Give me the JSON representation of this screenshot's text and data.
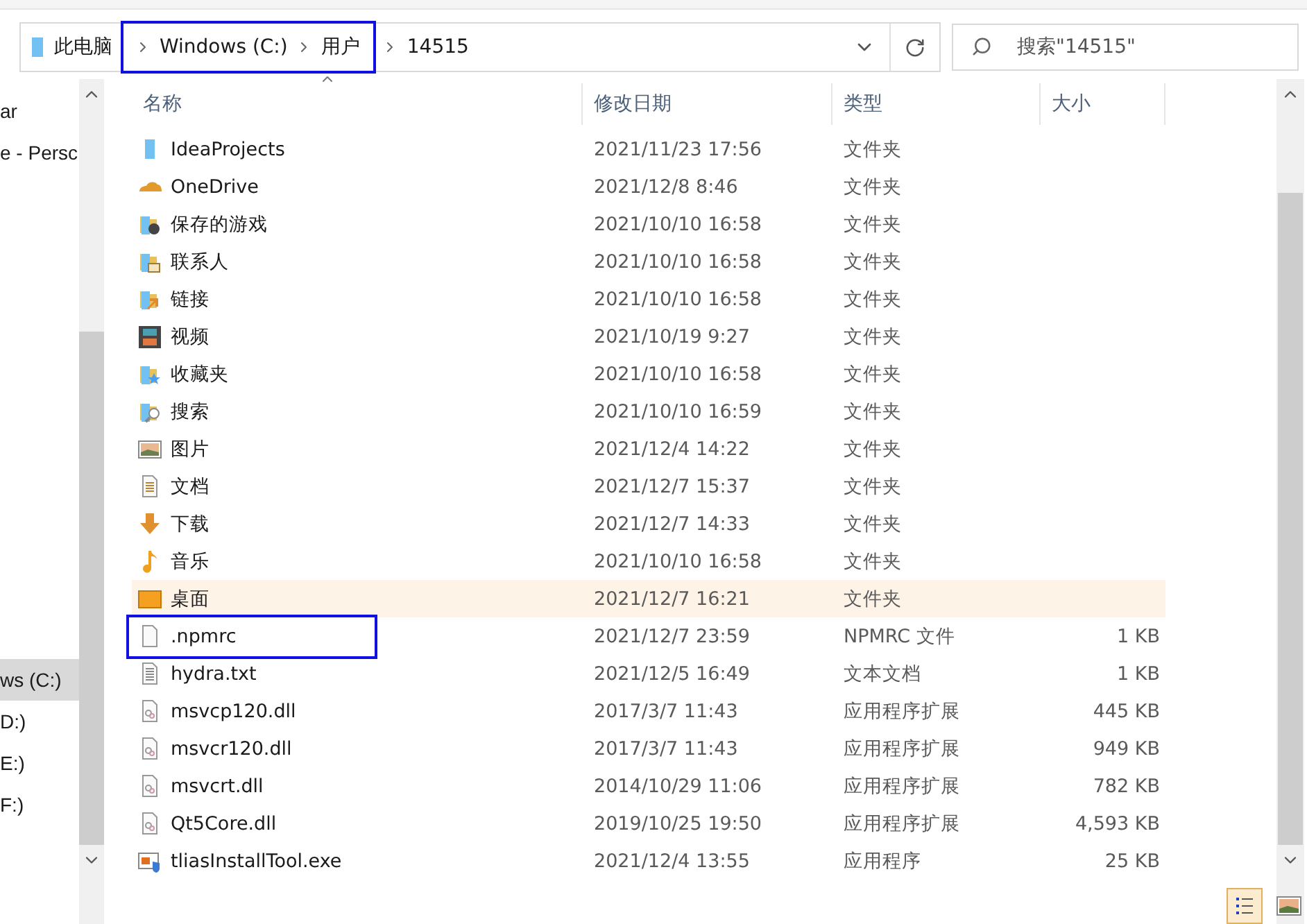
{
  "address_bar": {
    "segments": [
      {
        "label": "此电脑",
        "outlined": false
      },
      {
        "label": "Windows (C:)",
        "outlined": true
      },
      {
        "label": "用户",
        "outlined": true
      },
      {
        "label": "14515",
        "outlined": false
      }
    ]
  },
  "search": {
    "placeholder": "搜索\"14515\""
  },
  "nav_pane": {
    "items": [
      {
        "label": "ar",
        "selected": false
      },
      {
        "label": "e - Persc",
        "selected": false
      },
      {
        "label": "ws (C:)",
        "selected": true
      },
      {
        "label": "D:)",
        "selected": false
      },
      {
        "label": "E:)",
        "selected": false
      },
      {
        "label": "F:)",
        "selected": false
      }
    ]
  },
  "table": {
    "columns": [
      "名称",
      "修改日期",
      "类型",
      "大小"
    ],
    "rows": [
      {
        "kind": "folder",
        "name": "IdeaProjects",
        "date": "2021/11/23 17:56",
        "type": "文件夹",
        "size": "",
        "highlighted": false,
        "outlined": false
      },
      {
        "kind": "cloud",
        "name": "OneDrive",
        "date": "2021/12/8 8:46",
        "type": "文件夹",
        "size": "",
        "highlighted": false,
        "outlined": false
      },
      {
        "kind": "games",
        "name": "保存的游戏",
        "date": "2021/10/10 16:58",
        "type": "文件夹",
        "size": "",
        "highlighted": false,
        "outlined": false
      },
      {
        "kind": "contacts",
        "name": "联系人",
        "date": "2021/10/10 16:58",
        "type": "文件夹",
        "size": "",
        "highlighted": false,
        "outlined": false
      },
      {
        "kind": "links",
        "name": "链接",
        "date": "2021/10/10 16:58",
        "type": "文件夹",
        "size": "",
        "highlighted": false,
        "outlined": false
      },
      {
        "kind": "video",
        "name": "视频",
        "date": "2021/10/19 9:27",
        "type": "文件夹",
        "size": "",
        "highlighted": false,
        "outlined": false
      },
      {
        "kind": "favorites",
        "name": "收藏夹",
        "date": "2021/10/10 16:58",
        "type": "文件夹",
        "size": "",
        "highlighted": false,
        "outlined": false
      },
      {
        "kind": "searches",
        "name": "搜索",
        "date": "2021/10/10 16:59",
        "type": "文件夹",
        "size": "",
        "highlighted": false,
        "outlined": false
      },
      {
        "kind": "pictures",
        "name": "图片",
        "date": "2021/12/4 14:22",
        "type": "文件夹",
        "size": "",
        "highlighted": false,
        "outlined": false
      },
      {
        "kind": "documents",
        "name": "文档",
        "date": "2021/12/7 15:37",
        "type": "文件夹",
        "size": "",
        "highlighted": false,
        "outlined": false
      },
      {
        "kind": "downloads",
        "name": "下载",
        "date": "2021/12/7 14:33",
        "type": "文件夹",
        "size": "",
        "highlighted": false,
        "outlined": false
      },
      {
        "kind": "music",
        "name": "音乐",
        "date": "2021/10/10 16:58",
        "type": "文件夹",
        "size": "",
        "highlighted": false,
        "outlined": false
      },
      {
        "kind": "desktop",
        "name": "桌面",
        "date": "2021/12/7 16:21",
        "type": "文件夹",
        "size": "",
        "highlighted": true,
        "outlined": false
      },
      {
        "kind": "file",
        "name": ".npmrc",
        "date": "2021/12/7 23:59",
        "type": "NPMRC 文件",
        "size": "1 KB",
        "highlighted": false,
        "outlined": true
      },
      {
        "kind": "text",
        "name": "hydra.txt",
        "date": "2021/12/5 16:49",
        "type": "文本文档",
        "size": "1 KB",
        "highlighted": false,
        "outlined": false
      },
      {
        "kind": "dll",
        "name": "msvcp120.dll",
        "date": "2017/3/7 11:43",
        "type": "应用程序扩展",
        "size": "445 KB",
        "highlighted": false,
        "outlined": false
      },
      {
        "kind": "dll",
        "name": "msvcr120.dll",
        "date": "2017/3/7 11:43",
        "type": "应用程序扩展",
        "size": "949 KB",
        "highlighted": false,
        "outlined": false
      },
      {
        "kind": "dll",
        "name": "msvcrt.dll",
        "date": "2014/10/29 11:06",
        "type": "应用程序扩展",
        "size": "782 KB",
        "highlighted": false,
        "outlined": false
      },
      {
        "kind": "dll",
        "name": "Qt5Core.dll",
        "date": "2019/10/25 19:50",
        "type": "应用程序扩展",
        "size": "4,593 KB",
        "highlighted": false,
        "outlined": false
      },
      {
        "kind": "exe",
        "name": "tliasInstallTool.exe",
        "date": "2021/12/4 13:55",
        "type": "应用程序",
        "size": "25 KB",
        "highlighted": false,
        "outlined": false
      }
    ]
  },
  "view_buttons": [
    {
      "kind": "details",
      "selected": true
    },
    {
      "kind": "thumbnails",
      "selected": false
    }
  ]
}
